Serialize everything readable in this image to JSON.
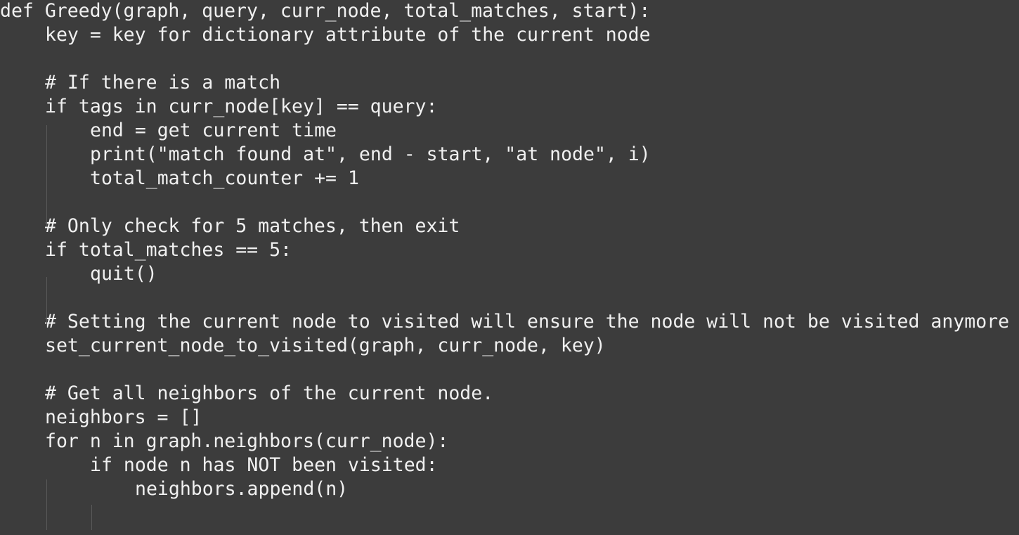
{
  "code_lines": [
    {
      "indent": 0,
      "text": "def Greedy(graph, query, curr_node, total_matches, start):"
    },
    {
      "indent": 1,
      "text": "key = key for dictionary attribute of the current node"
    },
    {
      "indent": 0,
      "text": ""
    },
    {
      "indent": 1,
      "text": "# If there is a match"
    },
    {
      "indent": 1,
      "text": "if tags in curr_node[key] == query:"
    },
    {
      "indent": 2,
      "text": "end = get current time"
    },
    {
      "indent": 2,
      "text": "print(\"match found at\", end - start, \"at node\", i)"
    },
    {
      "indent": 2,
      "text": "total_match_counter += 1"
    },
    {
      "indent": 0,
      "text": ""
    },
    {
      "indent": 1,
      "text": "# Only check for 5 matches, then exit"
    },
    {
      "indent": 1,
      "text": "if total_matches == 5:"
    },
    {
      "indent": 2,
      "text": "quit()"
    },
    {
      "indent": 0,
      "text": ""
    },
    {
      "indent": 1,
      "text": "# Setting the current node to visited will ensure the node will not be visited anymore"
    },
    {
      "indent": 1,
      "text": "set_current_node_to_visited(graph, curr_node, key)"
    },
    {
      "indent": 0,
      "text": ""
    },
    {
      "indent": 1,
      "text": "# Get all neighbors of the current node."
    },
    {
      "indent": 1,
      "text": "neighbors = []"
    },
    {
      "indent": 1,
      "text": "for n in graph.neighbors(curr_node):"
    },
    {
      "indent": 2,
      "text": "if node n has NOT been visited:"
    },
    {
      "indent": 3,
      "text": "neighbors.append(n)"
    }
  ],
  "colors": {
    "background": "#3c3c3c",
    "text": "#f0f0f0",
    "indent_guide": "#5a5a5a"
  }
}
